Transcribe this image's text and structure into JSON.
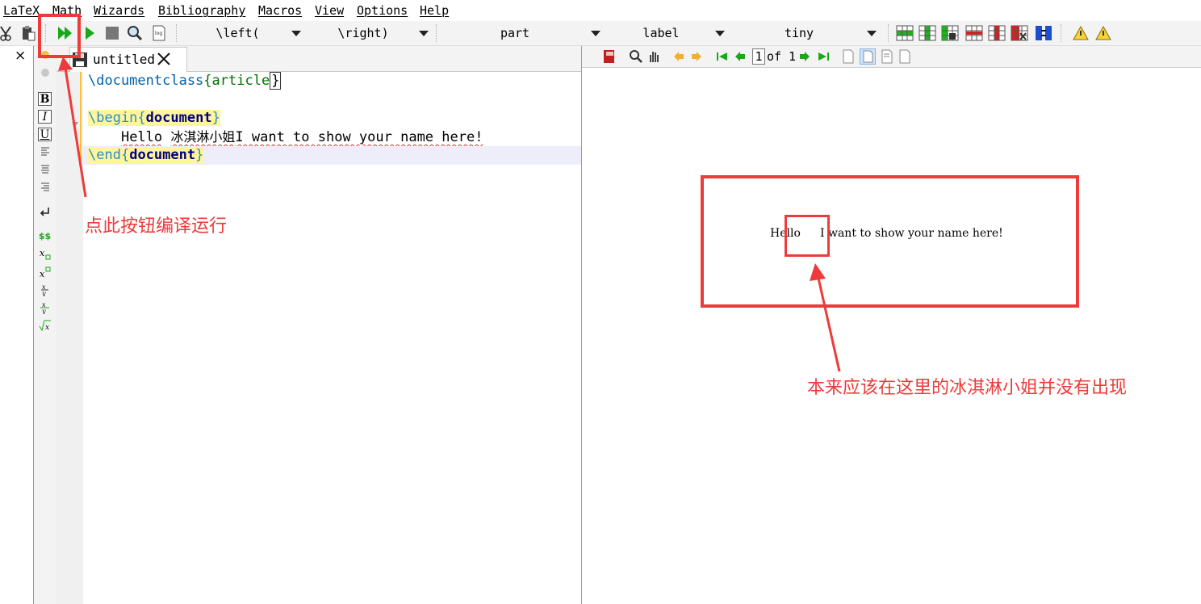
{
  "menubar": {
    "items": [
      "LaTeX",
      "Math",
      "Wizards",
      "Bibliography",
      "Macros",
      "View",
      "Options",
      "Help"
    ]
  },
  "toolbar": {
    "combos": [
      "\\left(",
      "\\right)",
      "part",
      "label",
      "tiny"
    ]
  },
  "structure_panel": {
    "close_label": "×"
  },
  "sidebar": {
    "bold": "B",
    "italic": "I",
    "underline": "U",
    "dollars": "$$"
  },
  "editor": {
    "tab_title": "untitled",
    "line1": {
      "cmd": "\\documentclass",
      "open": "{",
      "arg": "article",
      "close": "}"
    },
    "line3": {
      "cmd": "\\begin",
      "open": "{",
      "arg": "document",
      "close": "}"
    },
    "line4": {
      "indent": "    ",
      "hello": "Hello",
      "cjk": "冰淇淋小姐",
      "rest": "I want to show your name here!"
    },
    "line5": {
      "cmd": "\\end",
      "open": "{",
      "arg": "document",
      "close": "}"
    }
  },
  "viewer": {
    "page_current": "1",
    "page_of": "of",
    "page_total": "1",
    "pdf_hello": "Hello",
    "pdf_rest": "I want to show your name here!"
  },
  "annotations": {
    "compile_note": "点此按钮编译运行",
    "missing_note": "本来应该在这里的冰淇淋小姐并没有出现",
    "color": "#ee3a3a"
  }
}
